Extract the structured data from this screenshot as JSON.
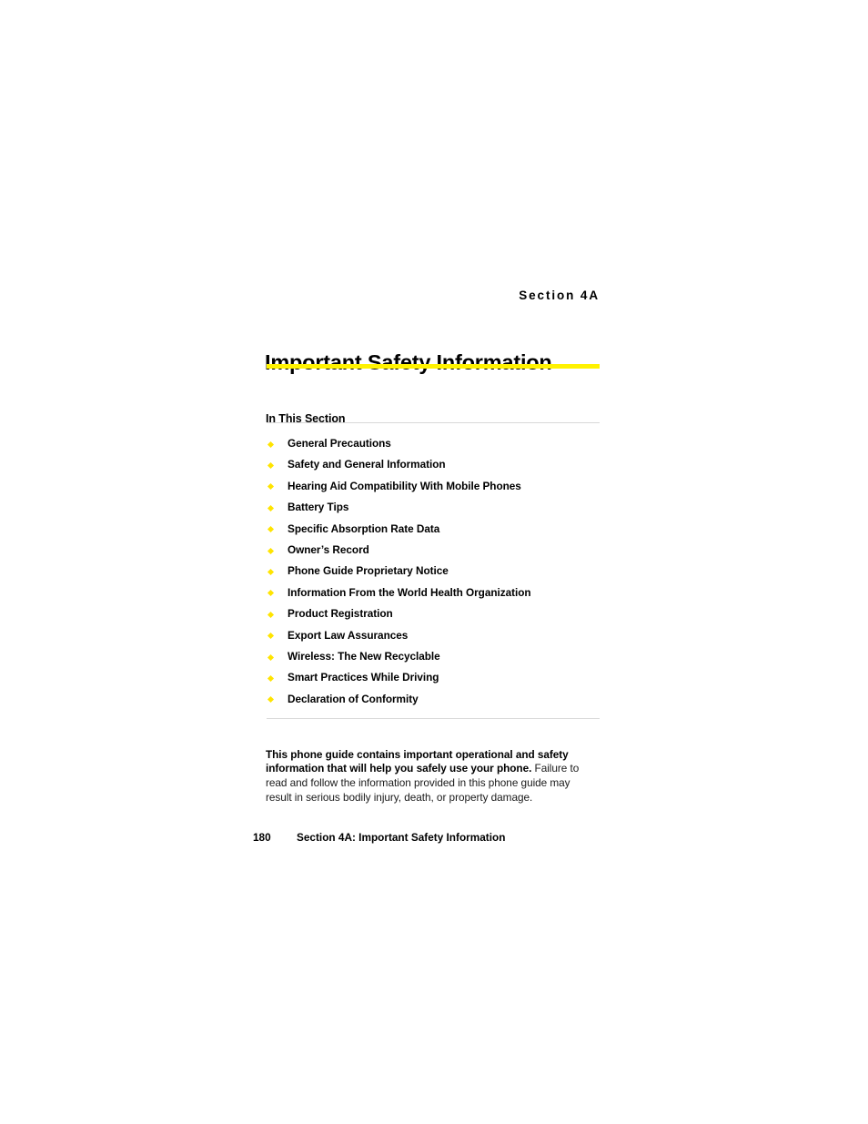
{
  "page": {
    "section_label": "Section 4A",
    "chapter_title": "Important Safety Information",
    "in_this_section_heading": "In This Section",
    "accent_color": "#fff200",
    "bullet_color": "#ffe400",
    "rule_color": "#d9d9d9"
  },
  "toc": {
    "items": [
      {
        "label": "General Precautions"
      },
      {
        "label": "Safety and General Information"
      },
      {
        "label": "Hearing Aid Compatibility With Mobile Phones"
      },
      {
        "label": "Battery Tips"
      },
      {
        "label": "Specific Absorption Rate Data"
      },
      {
        "label": "Owner’s Record"
      },
      {
        "label": "Phone Guide Proprietary Notice"
      },
      {
        "label": "Information From the World Health Organization"
      },
      {
        "label": "Product Registration"
      },
      {
        "label": "Export Law Assurances"
      },
      {
        "label": "Wireless: The New Recyclable"
      },
      {
        "label": "Smart Practices While Driving"
      },
      {
        "label": "Declaration of Conformity"
      }
    ]
  },
  "note": {
    "bold_lead": "This phone guide contains important operational and safety information that will help you safely use your phone.",
    "rest": " Failure to read and follow the information provided in this phone guide may result in serious bodily injury, death, or property damage."
  },
  "footer": {
    "page_number": "180",
    "running_title": "Section 4A: Important Safety Information"
  }
}
